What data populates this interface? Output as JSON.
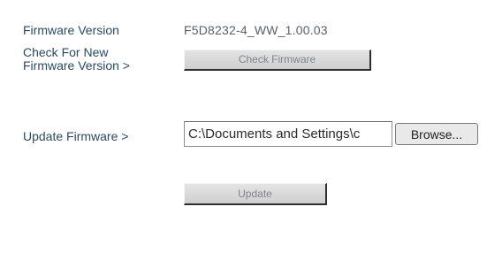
{
  "firmware_version": {
    "label": "Firmware Version",
    "value": "F5D8232-4_WW_1.00.03"
  },
  "check": {
    "label_line1": "Check For New",
    "label_line2": "Firmware Version >",
    "button_label": "Check Firmware"
  },
  "update": {
    "label": "Update Firmware >",
    "file_path": "C:\\Documents and Settings\\c",
    "browse_label": "Browse...",
    "button_label": "Update"
  },
  "colors": {
    "label_text": "#2c4a63",
    "value_text": "#5a6168",
    "button_face": "#d9d9d9"
  }
}
